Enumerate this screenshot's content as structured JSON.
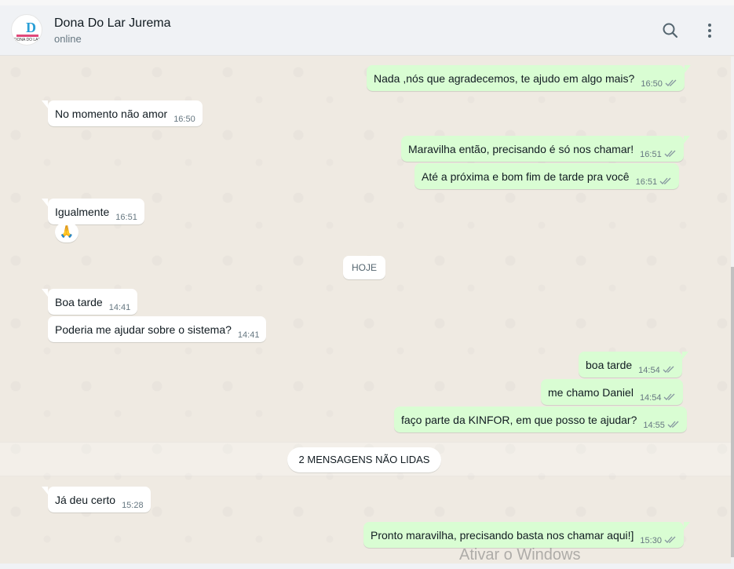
{
  "header": {
    "contact_name": "Dona Do Lar Jurema",
    "status": "online",
    "avatar_text": "DONA DO LAR"
  },
  "messages": [
    {
      "dir": "out",
      "text": "Nada ,nós que agradecemos, te ajudo em algo mais?",
      "time": "16:50"
    },
    {
      "dir": "in",
      "text": "No momento não amor",
      "time": "16:50"
    },
    {
      "dir": "out",
      "text": "Maravilha então, precisando é só nos chamar!",
      "time": "16:51"
    },
    {
      "dir": "out",
      "text": "Até a próxima e bom fim de tarde pra você",
      "time": "16:51"
    },
    {
      "dir": "in",
      "text": "Igualmente",
      "time": "16:51",
      "reaction": "🙏"
    },
    {
      "dir": "in",
      "text": "Boa tarde",
      "time": "14:41"
    },
    {
      "dir": "in",
      "text": "Poderia me ajudar sobre o sistema?",
      "time": "14:41"
    },
    {
      "dir": "out",
      "text": "boa tarde",
      "time": "14:54"
    },
    {
      "dir": "out",
      "text": "me chamo Daniel",
      "time": "14:54"
    },
    {
      "dir": "out",
      "text": "faço parte da KINFOR, em que posso te ajudar?",
      "time": "14:55"
    },
    {
      "dir": "in",
      "text": "Já deu certo",
      "time": "15:28"
    },
    {
      "dir": "out",
      "text": "Pronto maravilha, precisando basta nos chamar aqui!]",
      "time": "15:30"
    }
  ],
  "day_divider": "HOJE",
  "unread_divider": "2 MENSAGENS NÃO LIDAS",
  "watermark": "Ativar o Windows",
  "colors": {
    "outgoing_bubble": "#d9fdd3",
    "incoming_bubble": "#ffffff",
    "chat_background": "#efeae2",
    "header_background": "#f0f2f5",
    "read_tick": "#8696a0"
  },
  "icons": {
    "search": "search-icon",
    "menu": "menu-dots-icon",
    "tick": "double-check-icon"
  }
}
